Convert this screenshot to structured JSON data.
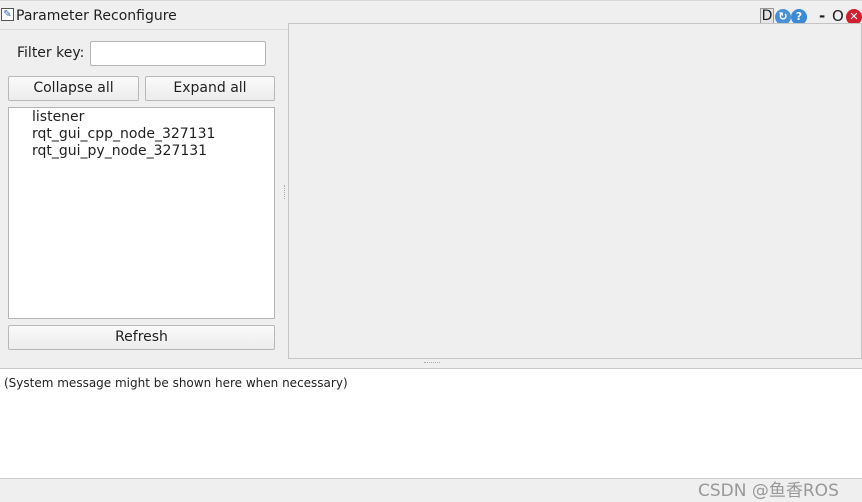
{
  "window": {
    "title": "Parameter Reconfigure",
    "icon": "pencil-icon",
    "buttons": {
      "debug": "D",
      "minimize": "-",
      "restore": "O"
    }
  },
  "filter": {
    "label": "Filter key:",
    "value": "",
    "placeholder": ""
  },
  "buttons": {
    "collapse_all": "Collapse all",
    "expand_all": "Expand all",
    "refresh": "Refresh"
  },
  "tree": {
    "items": [
      "listener",
      "rqt_gui_cpp_node_327131",
      "rqt_gui_py_node_327131"
    ]
  },
  "status": {
    "message": "(System message might be shown here when necessary)"
  },
  "watermark": "CSDN @鱼香ROS",
  "colors": {
    "close": "#d0202e",
    "help": "#3a8ad6",
    "reload": "#4a90d6"
  }
}
